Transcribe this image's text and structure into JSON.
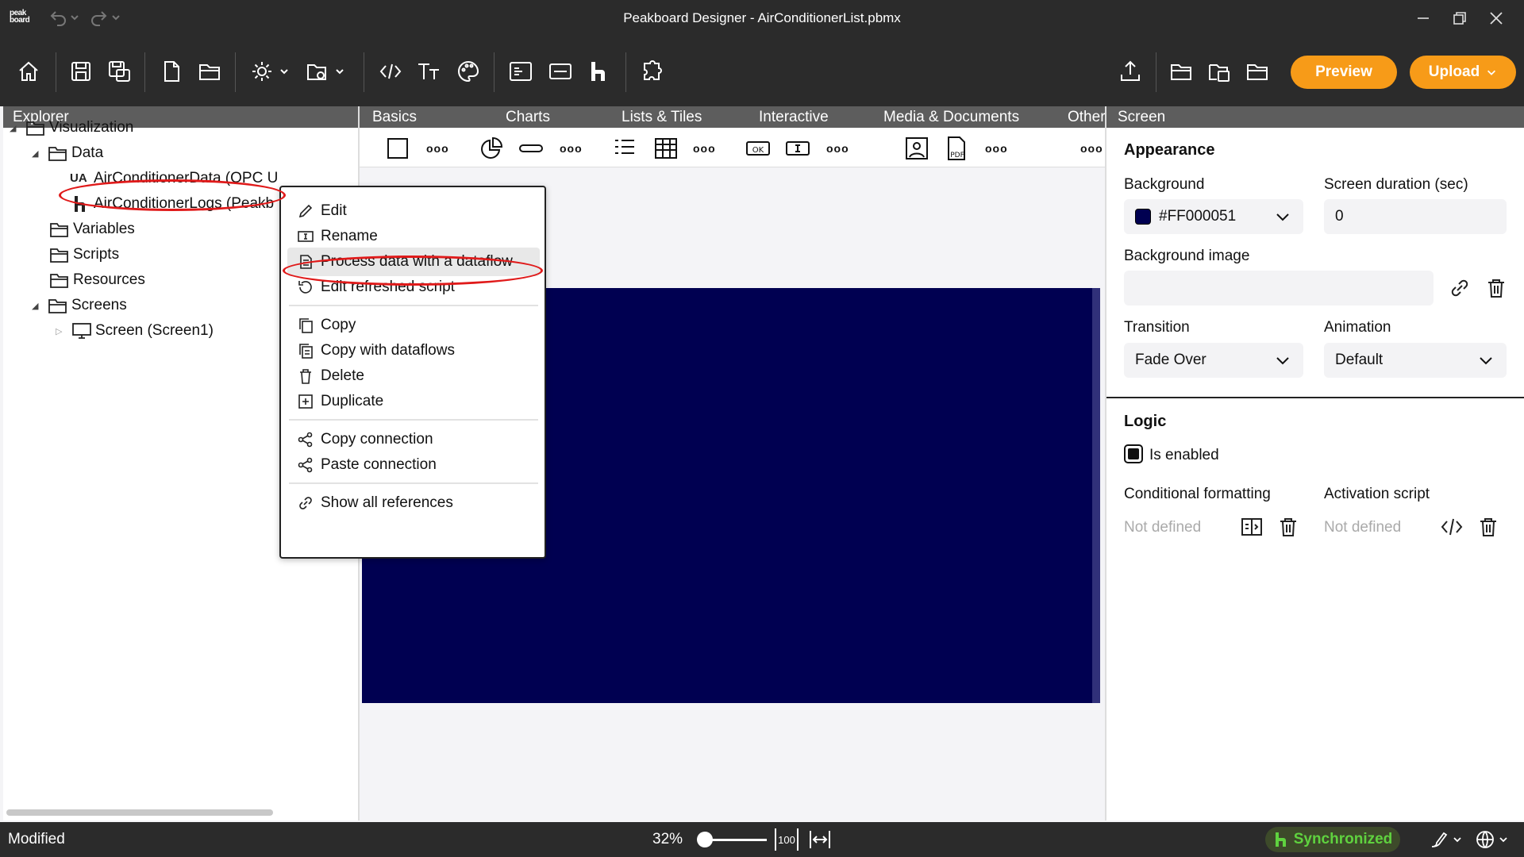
{
  "app": {
    "logo_text": "peak board",
    "title": "Peakboard Designer - AirConditionerList.pbmx"
  },
  "toolbar": {
    "preview_label": "Preview",
    "upload_label": "Upload"
  },
  "explorer": {
    "header": "Explorer",
    "items": [
      {
        "label": "Visualization"
      },
      {
        "label": "Data"
      },
      {
        "label": "AirConditionerData (OPC U"
      },
      {
        "label": "AirConditionerLogs (Peakb"
      },
      {
        "label": "Variables"
      },
      {
        "label": "Scripts"
      },
      {
        "label": "Resources"
      },
      {
        "label": "Screens"
      },
      {
        "label": "Screen (Screen1)"
      }
    ]
  },
  "palette": {
    "tabs": [
      {
        "label": "Basics"
      },
      {
        "label": "Charts"
      },
      {
        "label": "Lists & Tiles"
      },
      {
        "label": "Interactive"
      },
      {
        "label": "Media & Documents"
      },
      {
        "label": "Other"
      }
    ]
  },
  "context_menu": {
    "items": [
      {
        "label": "Edit",
        "icon": "pencil-icon"
      },
      {
        "label": "Rename",
        "icon": "rename-icon"
      },
      {
        "label": "Process data with a dataflow",
        "icon": "dataflow-icon"
      },
      {
        "label": "Edit refreshed script",
        "icon": "refresh-icon"
      },
      {
        "label": "Copy",
        "icon": "copy-icon"
      },
      {
        "label": "Copy with dataflows",
        "icon": "copy-dataflows-icon"
      },
      {
        "label": "Delete",
        "icon": "trash-icon"
      },
      {
        "label": "Duplicate",
        "icon": "duplicate-icon"
      },
      {
        "label": "Copy connection",
        "icon": "connection-icon"
      },
      {
        "label": "Paste connection",
        "icon": "connection-icon"
      },
      {
        "label": "Show all references",
        "icon": "link-icon"
      }
    ]
  },
  "properties": {
    "header": "Screen",
    "appearance_title": "Appearance",
    "background_label": "Background",
    "background_value": "#FF000051",
    "duration_label": "Screen duration (sec)",
    "duration_value": "0",
    "bg_image_label": "Background image",
    "transition_label": "Transition",
    "transition_value": "Fade Over",
    "animation_label": "Animation",
    "animation_value": "Default",
    "logic_title": "Logic",
    "enabled_label": "Is enabled",
    "enabled": true,
    "cond_format_label": "Conditional formatting",
    "cond_format_value": "Not defined",
    "activation_label": "Activation script",
    "activation_value": "Not defined"
  },
  "status": {
    "state": "Modified",
    "zoom": "32%",
    "zoom_fraction": 0.32,
    "zoom_100": "100",
    "sync_label": "Synchronized"
  },
  "colors": {
    "accent": "#f79b18",
    "canvas_bg": "#000051",
    "highlight": "#e01a1a",
    "sync_green": "#5fd23f"
  }
}
